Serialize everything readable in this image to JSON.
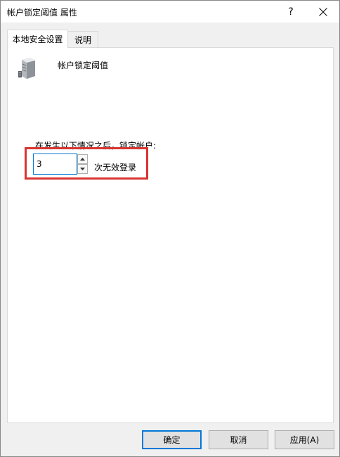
{
  "window": {
    "title": "帐户锁定阈值 属性",
    "help_label": "?"
  },
  "tabs": [
    {
      "label": "本地安全设置",
      "active": true
    },
    {
      "label": "说明",
      "active": false
    }
  ],
  "policy": {
    "icon": "server-icon",
    "name": "帐户锁定阈值"
  },
  "lockout": {
    "prompt": "在发生以下情况之后，锁定帐户:",
    "value": "3",
    "suffix": "次无效登录"
  },
  "buttons": {
    "ok": "确定",
    "cancel": "取消",
    "apply": "应用(A)"
  },
  "colors": {
    "highlight": "#d9352f",
    "focus": "#0078d7"
  }
}
